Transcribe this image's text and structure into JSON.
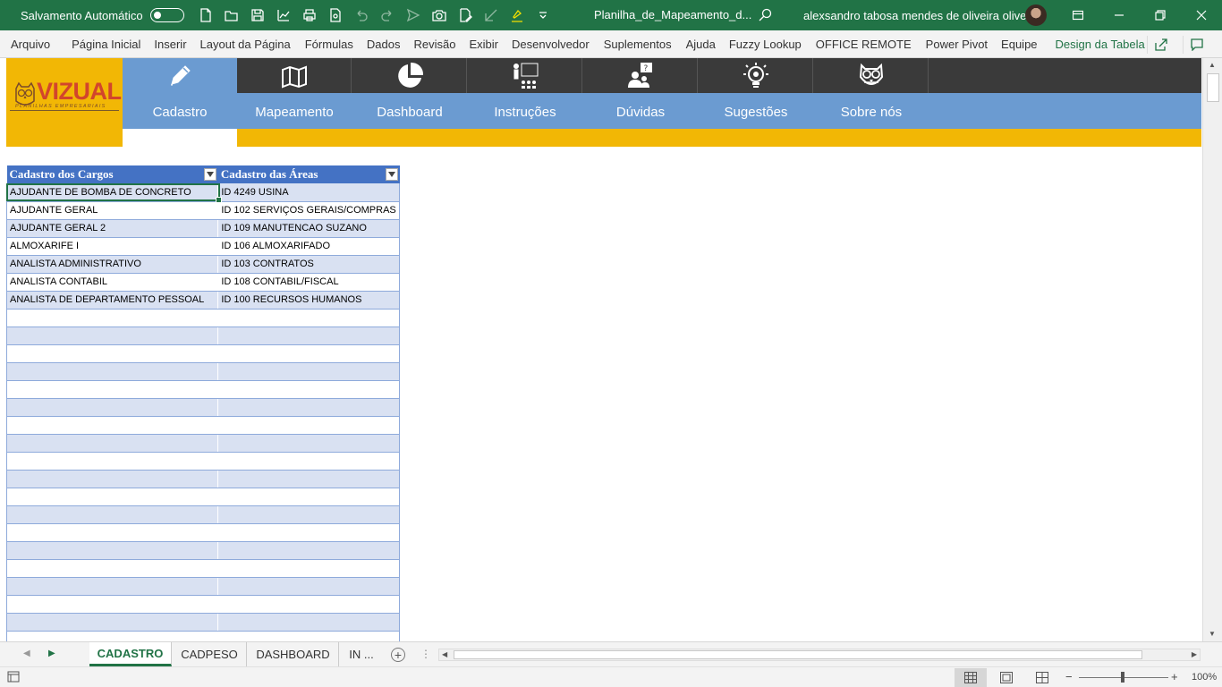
{
  "titlebar": {
    "autosave_label": "Salvamento Automático",
    "doc_title": "Planilha_de_Mapeamento_d...",
    "user_name": "alexsandro tabosa mendes de oliveira oliveira"
  },
  "ribbon": {
    "tabs": [
      "Arquivo",
      "Página Inicial",
      "Inserir",
      "Layout da Página",
      "Fórmulas",
      "Dados",
      "Revisão",
      "Exibir",
      "Desenvolvedor",
      "Suplementos",
      "Ajuda",
      "Fuzzy Lookup",
      "OFFICE REMOTE",
      "Power Pivot",
      "Equipe",
      "Design da Tabela"
    ],
    "active_context_tab": "Design da Tabela"
  },
  "logo": {
    "text": "VIZUAL",
    "subtitle": "PLANILHAS EMPRESARIAIS"
  },
  "nav": {
    "items": [
      {
        "label": "Cadastro",
        "icon": "pencil-icon"
      },
      {
        "label": "Mapeamento",
        "icon": "map-icon"
      },
      {
        "label": "Dashboard",
        "icon": "pie-chart-icon"
      },
      {
        "label": "Instruções",
        "icon": "presentation-icon"
      },
      {
        "label": "Dúvidas",
        "icon": "question-person-icon"
      },
      {
        "label": "Sugestões",
        "icon": "lightbulb-icon"
      },
      {
        "label": "Sobre nós",
        "icon": "owl-icon"
      }
    ],
    "active": "Cadastro"
  },
  "table": {
    "headers": [
      "Cadastro dos Cargos",
      "Cadastro das Áreas"
    ],
    "rows": [
      [
        "AJUDANTE DE BOMBA DE CONCRETO",
        "ID 4249 USINA"
      ],
      [
        "AJUDANTE GERAL",
        "ID 102 SERVIÇOS GERAIS/COMPRAS"
      ],
      [
        "AJUDANTE GERAL 2",
        "ID 109 MANUTENCAO SUZANO"
      ],
      [
        "ALMOXARIFE I",
        "ID 106 ALMOXARIFADO"
      ],
      [
        "ANALISTA ADMINISTRATIVO",
        "ID 103 CONTRATOS"
      ],
      [
        "ANALISTA CONTABIL",
        "ID 108 CONTABIL/FISCAL"
      ],
      [
        "ANALISTA DE DEPARTAMENTO PESSOAL",
        "ID 100 RECURSOS HUMANOS"
      ]
    ]
  },
  "sheet_tabs": {
    "tabs": [
      "CADASTRO",
      "CADPESO",
      "DASHBOARD",
      "IN ..."
    ],
    "active": "CADASTRO"
  },
  "statusbar": {
    "zoom": "100%"
  },
  "colors": {
    "excel_green": "#217346",
    "nav_dark": "#3a3a3a",
    "nav_blue": "#6b9bd1",
    "brand_yellow": "#f2b705",
    "table_header": "#4472c4",
    "table_band": "#d9e1f2"
  }
}
